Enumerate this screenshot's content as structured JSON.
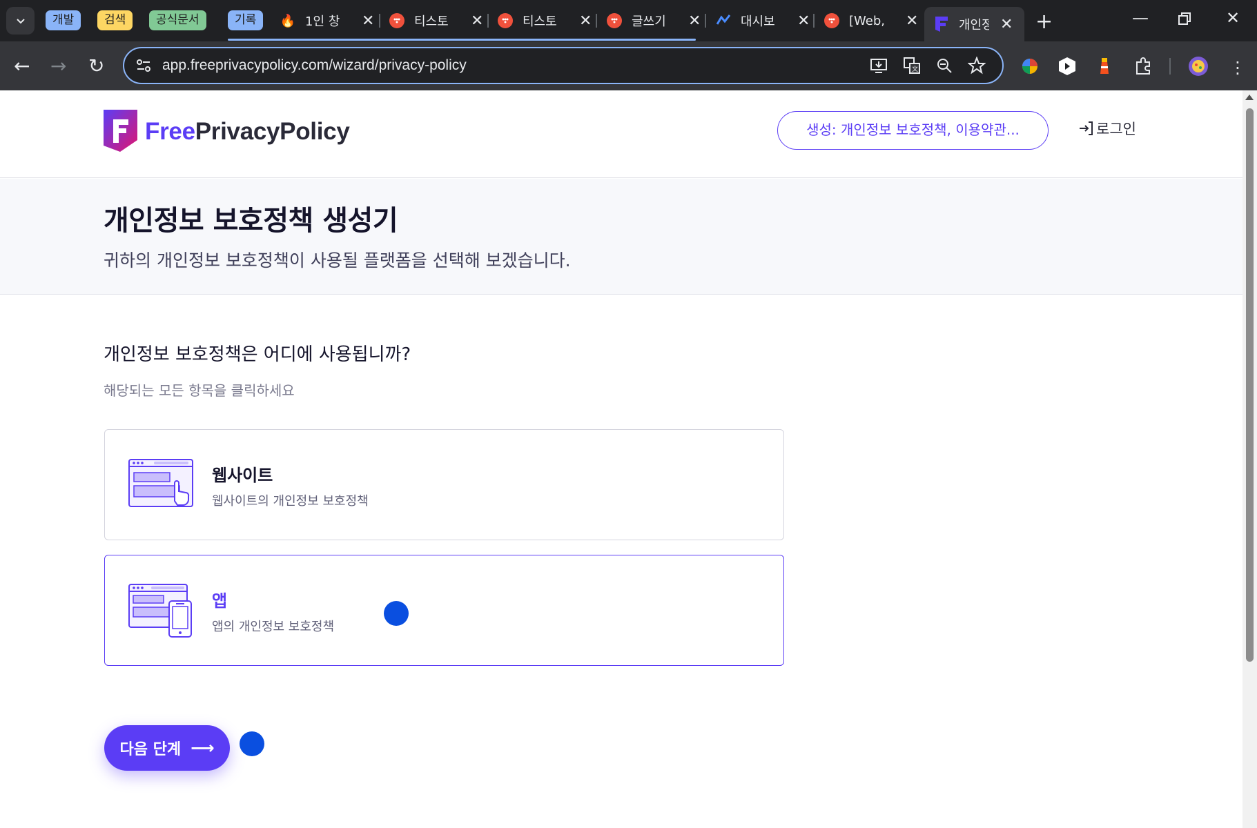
{
  "browser": {
    "tab_groups": [
      {
        "label": "개발",
        "color": "#8ab4f8"
      },
      {
        "label": "검색",
        "color": "#fdd663"
      },
      {
        "label": "공식문서",
        "color": "#81c995"
      },
      {
        "label": "기록",
        "color": "#8ab4f8"
      }
    ],
    "tabs": [
      {
        "title": "1인 창",
        "favicon": "fire-icon"
      },
      {
        "title": "티스토",
        "favicon": "tistory-icon"
      },
      {
        "title": "티스토",
        "favicon": "tistory-icon"
      },
      {
        "title": "글쓰기",
        "favicon": "tistory-icon"
      },
      {
        "title": "대시보",
        "favicon": "chart-icon"
      },
      {
        "title": "[Web,",
        "favicon": "tistory-icon"
      },
      {
        "title": "개인정",
        "favicon": "freeprivacypolicy-icon",
        "active": true
      }
    ],
    "url": "app.freeprivacypolicy.com/wizard/privacy-policy"
  },
  "header": {
    "logo_free": "Free",
    "logo_rest": "PrivacyPolicy",
    "generate_button": "생성: 개인정보 보호정책, 이용약관...",
    "login_link": "로그인"
  },
  "hero": {
    "title": "개인정보 보호정책 생성기",
    "subtitle": "귀하의 개인정보 보호정책이 사용될 플랫폼을 선택해 보겠습니다."
  },
  "form": {
    "question": "개인정보 보호정책은 어디에 사용됩니까?",
    "hint": "해당되는 모든 항목을 클릭하세요",
    "options": [
      {
        "title": "웹사이트",
        "desc": "웹사이트의 개인정보 보호정책",
        "selected": false
      },
      {
        "title": "앱",
        "desc": "앱의 개인정보 보호정책",
        "selected": true
      }
    ],
    "next_button": "다음 단계"
  },
  "colors": {
    "brand": "#5b3df5",
    "click_marker": "#0a4fe0"
  }
}
